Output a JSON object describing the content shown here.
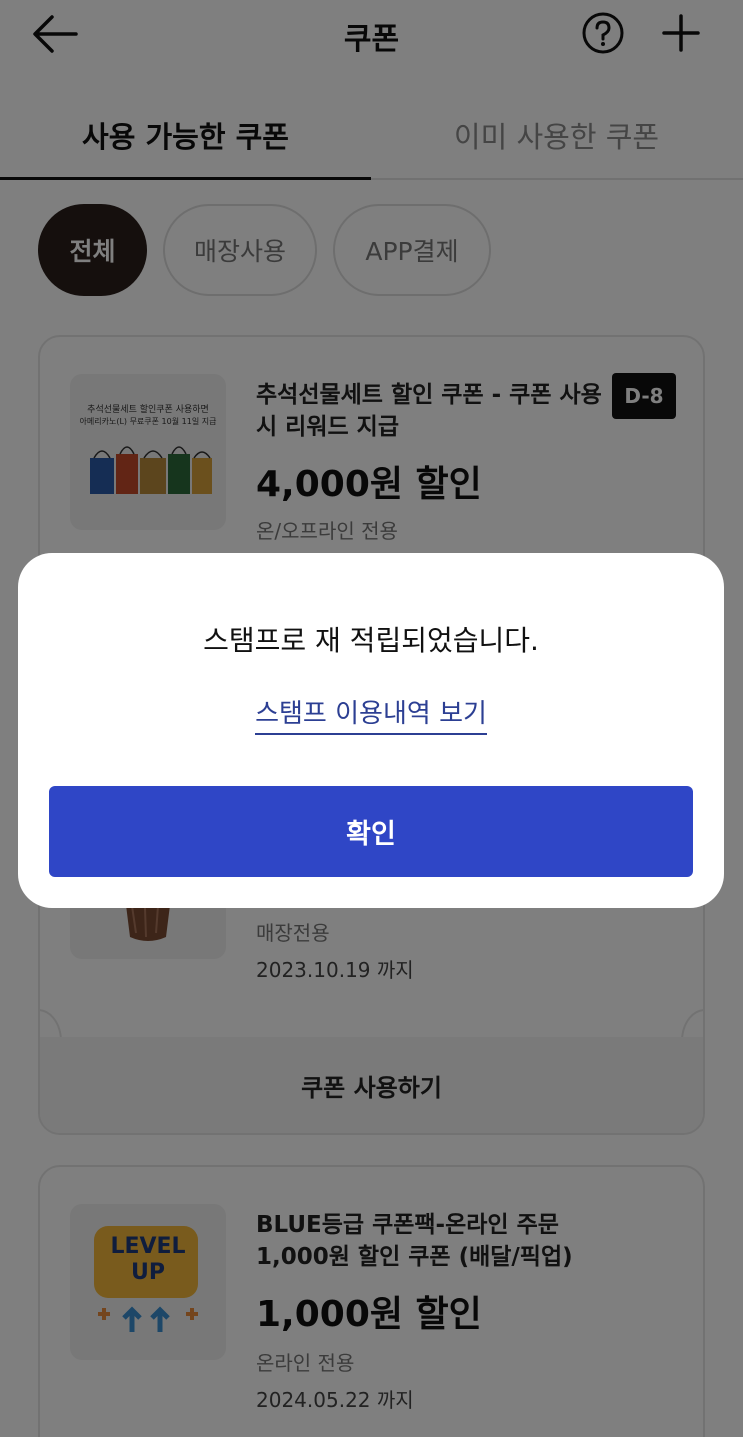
{
  "header": {
    "title": "쿠폰",
    "back_icon": "arrow-left-icon",
    "help_icon": "question-circle-icon",
    "add_icon": "plus-icon"
  },
  "tabs": [
    {
      "label": "사용 가능한 쿠폰",
      "active": true
    },
    {
      "label": "이미 사용한 쿠폰",
      "active": false
    }
  ],
  "filters": [
    {
      "label": "전체",
      "selected": true
    },
    {
      "label": "매장사용",
      "selected": false
    },
    {
      "label": "APP결제",
      "selected": false
    }
  ],
  "coupons": [
    {
      "thumb_text_1": "추석선물세트 할인쿠폰 사용하면",
      "thumb_text_2": "아메리카노(L) 무료쿠폰 10월 11일 지급",
      "title": "추석선물세트 할인 쿠폰 - 쿠폰 사용 시 리워드 지급",
      "amount": "4,000원 할인",
      "channel": "온/오프라인 전용",
      "badge": "D-8"
    },
    {
      "channel": "매장전용",
      "expiry": "2023.10.19 까지",
      "action_label": "쿠폰 사용하기"
    },
    {
      "thumb_text_1": "LEVEL",
      "thumb_text_2": "UP",
      "title": "BLUE등급 쿠폰팩-온라인 주문 1,000원 할인 쿠폰 (배달/픽업)",
      "amount": "1,000원 할인",
      "channel": "온라인 전용",
      "expiry": "2024.05.22 까지"
    }
  ],
  "modal": {
    "message": "스탬프로 재 적립되었습니다.",
    "link_label": "스탬프 이용내역 보기",
    "confirm_label": "확인"
  },
  "colors": {
    "primary_button": "#2f46c6",
    "link": "#2c3f93",
    "selected_chip": "#2a1f1b",
    "overlay": "rgba(0,0,0,0.5)"
  }
}
